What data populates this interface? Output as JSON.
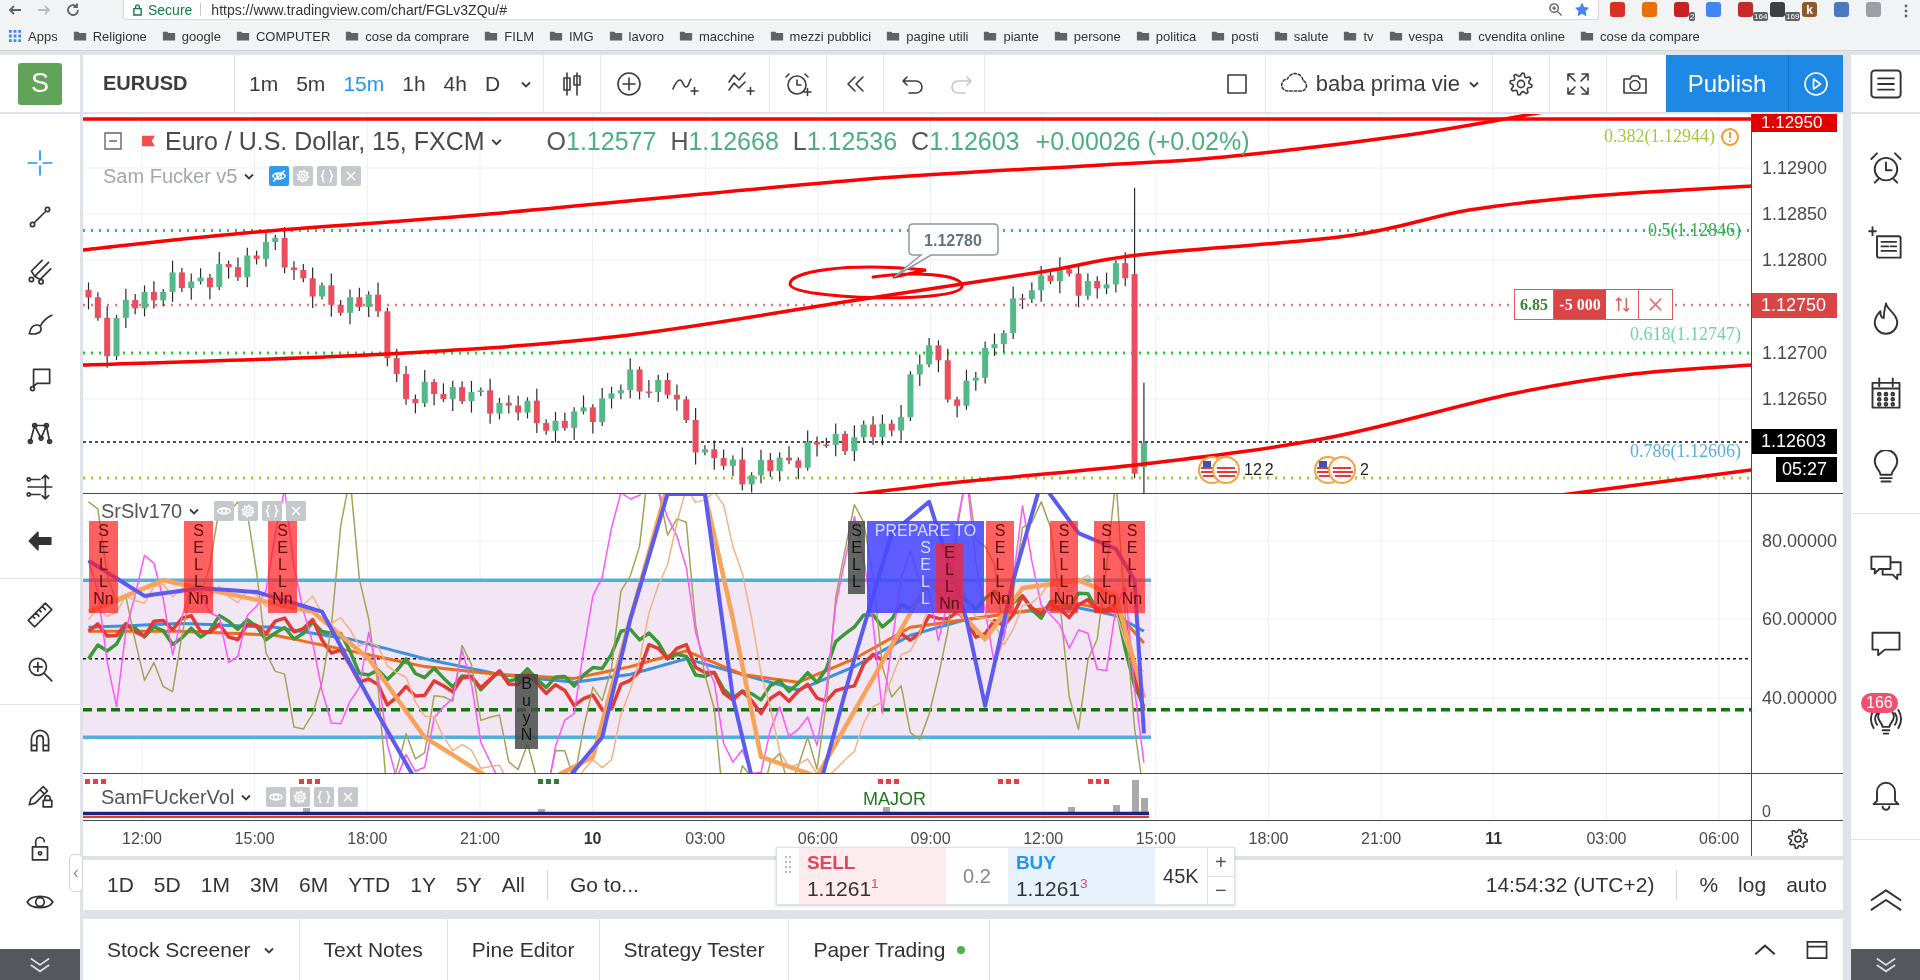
{
  "browser": {
    "security_label": "Secure",
    "url": "https://www.tradingview.com/chart/FGLv3ZQu/#",
    "bookmarked": true,
    "extensions": [
      {
        "color": "#d93025"
      },
      {
        "color": "#e8710a"
      },
      {
        "color": "#c5221f",
        "badge": "2"
      },
      {
        "color": "#4285f4"
      },
      {
        "color": "#c62828",
        "badge": "164"
      },
      {
        "color": "#3c4043",
        "badge": "169"
      },
      {
        "color": "#8d5a2b",
        "label": "k"
      },
      {
        "color": "#4a78c2"
      },
      {
        "color": "#9aa0a6"
      }
    ]
  },
  "bookmarks": {
    "apps": "Apps",
    "folders": [
      "Religione",
      "google",
      "COMPUTER",
      "cose da comprare",
      "FILM",
      "IMG",
      "lavoro",
      "macchine",
      "mezzi pubblici",
      "pagine utili",
      "piante",
      "persone",
      "politica",
      "posti",
      "salute",
      "tv",
      "vespa",
      "cvendita online",
      "cose da compare"
    ]
  },
  "toolbar": {
    "avatar": "S",
    "symbol": "EURUSD",
    "intervals": [
      {
        "label": "1m",
        "selected": false
      },
      {
        "label": "5m",
        "selected": false
      },
      {
        "label": "15m",
        "selected": true
      },
      {
        "label": "1h",
        "selected": false
      },
      {
        "label": "4h",
        "selected": false
      },
      {
        "label": "D",
        "selected": false
      }
    ],
    "redo_enabled": false,
    "layout_name": "baba prima vie",
    "publish": "Publish"
  },
  "left_toolbar": {
    "tools": [
      {
        "selected": true
      },
      {
        "selected": false
      },
      {
        "selected": false
      },
      {
        "selected": false
      },
      {
        "selected": false
      },
      {
        "selected": false
      },
      {
        "selected": false
      },
      {
        "selected": false
      },
      {
        "selected": false
      },
      {
        "selected": false
      },
      {
        "selected": false
      },
      {
        "selected": false
      },
      {
        "selected": false
      },
      {
        "selected": false
      }
    ]
  },
  "right_sidebar": {
    "items": [
      {
        "selected": false
      },
      {
        "selected": false
      },
      {
        "selected": false
      },
      {
        "selected": false
      },
      {
        "selected": false
      },
      {
        "selected": false
      },
      {
        "selected": false
      },
      {
        "selected": false,
        "badge": "166"
      },
      {
        "selected": false
      },
      {
        "selected": false
      }
    ]
  },
  "main_pane": {
    "legend": {
      "title": "Euro / U.S. Dollar, 15, FXCM",
      "ohlc": [
        {
          "key": "O",
          "value": "1.12577"
        },
        {
          "key": "H",
          "value": "1.12668"
        },
        {
          "key": "L",
          "value": "1.12536"
        },
        {
          "key": "C",
          "value": "1.12603"
        }
      ],
      "change": "+0.00026 (+0.02%)",
      "positive": true
    },
    "study": {
      "name": "Sam Fucker v5",
      "hidden": true
    },
    "callout": "1.12780",
    "fib_levels": [
      {
        "label": "0.382(1.12944)",
        "color": "#a5c83c"
      },
      {
        "label": "0.5(1.12846)",
        "color": "#2fae4a"
      },
      {
        "label": "0.618(1.12747)",
        "color": "#6fd3a8"
      },
      {
        "label": "0.786(1.12606)",
        "color": "#5aaedc"
      }
    ],
    "position": {
      "pnl": "6.85",
      "quantity": "-5 000"
    },
    "events": [
      {
        "labels": [
          "12",
          "2"
        ]
      },
      {
        "labels": [
          "2"
        ]
      }
    ]
  },
  "price_axis": {
    "ticks": [
      "1.12900",
      "1.12850",
      "1.12800",
      "1.12700",
      "1.12650"
    ],
    "alert_price": "1.12950",
    "order_price": "1.12750",
    "last_price": "1.12603",
    "countdown": "05:27"
  },
  "oscillator_pane": {
    "name": "SrSlv170",
    "hidden": false,
    "signals": [
      {
        "kind": "alert",
        "text": "SELL",
        "tag": "Nn"
      },
      {
        "kind": "alert",
        "text": "SELL",
        "tag": "Nn"
      },
      {
        "kind": "alert",
        "text": "SELL",
        "tag": "Nn"
      },
      {
        "kind": "note",
        "text": "Buy",
        "tag": "N"
      },
      {
        "kind": "note",
        "text": "SELL"
      },
      {
        "kind": "prepare",
        "head": "PREPARE TO",
        "text": "SELL"
      },
      {
        "kind": "alert",
        "text": "ELL",
        "tag": "Nn"
      },
      {
        "kind": "alert",
        "text": "SELL",
        "tag": "Nn"
      },
      {
        "kind": "alert",
        "text": "SELL",
        "tag": "Nn"
      },
      {
        "kind": "alert",
        "text": "SELL",
        "tag": "Nn"
      },
      {
        "kind": "alert",
        "text": "SELL",
        "tag": "Nn"
      }
    ],
    "axis": [
      "80.00000",
      "60.00000",
      "40.00000"
    ]
  },
  "volume_pane": {
    "name": "SamFUckerVol",
    "hidden": false,
    "label": "MAJOR",
    "axis": "0"
  },
  "time_axis": [
    {
      "text": "12:00",
      "kind": "time"
    },
    {
      "text": "15:00",
      "kind": "time"
    },
    {
      "text": "18:00",
      "kind": "time"
    },
    {
      "text": "21:00",
      "kind": "time"
    },
    {
      "text": "10",
      "kind": "day"
    },
    {
      "text": "03:00",
      "kind": "time"
    },
    {
      "text": "06:00",
      "kind": "time"
    },
    {
      "text": "09:00",
      "kind": "time"
    },
    {
      "text": "12:00",
      "kind": "time"
    },
    {
      "text": "15:00",
      "kind": "time"
    },
    {
      "text": "18:00",
      "kind": "time"
    },
    {
      "text": "21:00",
      "kind": "time"
    },
    {
      "text": "11",
      "kind": "day"
    },
    {
      "text": "03:00",
      "kind": "time"
    },
    {
      "text": "06:00",
      "kind": "time"
    }
  ],
  "range_bar": {
    "ranges": [
      "1D",
      "5D",
      "1M",
      "3M",
      "6M",
      "YTD",
      "1Y",
      "5Y",
      "All"
    ],
    "goto": "Go to...",
    "trade": {
      "sell_label": "SELL",
      "sell_price": "1.1261$^{1}$",
      "spread": "0.2",
      "buy_label": "BUY",
      "buy_price": "1.1261$^{3}$",
      "quantity": "45K",
      "increase": "+",
      "decrease": "−"
    },
    "clock": "14:54:32 (UTC+2)",
    "scale": [
      {
        "label": "%",
        "selected": false
      },
      {
        "label": "log",
        "selected": false
      },
      {
        "label": "auto",
        "selected": false
      }
    ]
  },
  "bottom_panel": {
    "tabs": [
      {
        "label": "Stock Screener",
        "selected": false,
        "menu": true,
        "status_dot": false
      },
      {
        "label": "Text Notes",
        "selected": false,
        "menu": false,
        "status_dot": false
      },
      {
        "label": "Pine Editor",
        "selected": false,
        "menu": false,
        "status_dot": false
      },
      {
        "label": "Strategy Tester",
        "selected": false,
        "menu": false,
        "status_dot": false
      },
      {
        "label": "Paper Trading",
        "selected": false,
        "menu": false,
        "status_dot": true
      }
    ]
  }
}
